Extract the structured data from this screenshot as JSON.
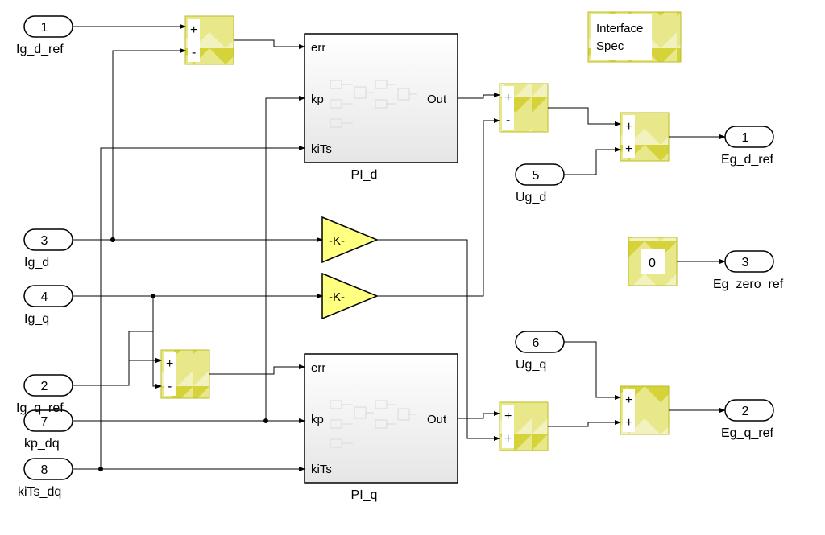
{
  "inports": {
    "p1": {
      "num": "1",
      "name": "Ig_d_ref"
    },
    "p2": {
      "num": "2",
      "name": "Ig_q_ref"
    },
    "p3": {
      "num": "3",
      "name": "Ig_d"
    },
    "p4": {
      "num": "4",
      "name": "Ig_q"
    },
    "p5": {
      "num": "5",
      "name": "Ug_d"
    },
    "p6": {
      "num": "6",
      "name": "Ug_q"
    },
    "p7": {
      "num": "7",
      "name": "kp_dq"
    },
    "p8": {
      "num": "8",
      "name": "kiTs_dq"
    }
  },
  "outports": {
    "o1": {
      "num": "1",
      "name": "Eg_d_ref"
    },
    "o2": {
      "num": "2",
      "name": "Eg_q_ref"
    },
    "o3": {
      "num": "3",
      "name": "Eg_zero_ref"
    }
  },
  "subsystems": {
    "pi_d": {
      "name": "PI_d",
      "in": [
        "err",
        "kp",
        "kiTs"
      ],
      "out": "Out"
    },
    "pi_q": {
      "name": "PI_q",
      "in": [
        "err",
        "kp",
        "kiTs"
      ],
      "out": "Out"
    }
  },
  "gains": {
    "g1": "-K-",
    "g2": "-K-"
  },
  "constant": {
    "c0": "0"
  },
  "interface": {
    "line1": "Interface",
    "line2": "Spec"
  },
  "sums": {
    "s1": {
      "signs": [
        "+",
        "-"
      ]
    },
    "s2": {
      "signs": [
        "+",
        "-"
      ]
    },
    "s3": {
      "signs": [
        "+",
        "-"
      ]
    },
    "s4": {
      "signs": [
        "+",
        "+"
      ]
    },
    "s5": {
      "signs": [
        "+",
        "+"
      ]
    },
    "s6": {
      "signs": [
        "+",
        "+"
      ]
    }
  }
}
